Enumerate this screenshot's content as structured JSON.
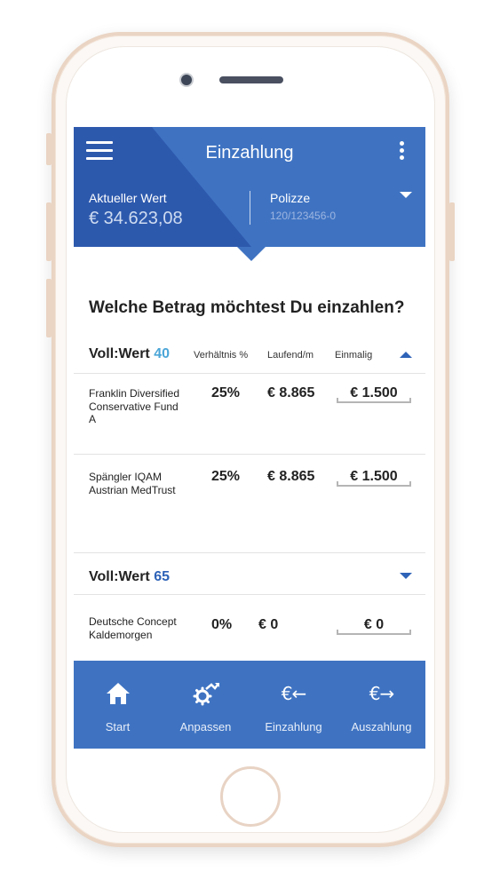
{
  "header": {
    "title": "Einzahlung",
    "current_value_label": "Aktueller Wert",
    "current_value": "€ 34.623,08",
    "policy_label": "Polizze",
    "policy_number": "120/123456-0"
  },
  "question": "Welche Betrag möchtest Du einzahlen?",
  "groups": [
    {
      "title_prefix": "Voll:Wert",
      "title_number": "40",
      "expanded": true,
      "columns": [
        "Verhältnis %",
        "Laufend/m",
        "Einmalig"
      ],
      "funds": [
        {
          "name": "Franklin Diversified Conservative Fund A",
          "pct": "25%",
          "laufend": "€ 8.865",
          "einmalig": "€ 1.500"
        },
        {
          "name": "Spängler IQAM Austrian MedTrust",
          "pct": "25%",
          "laufend": "€ 8.865",
          "einmalig": "€ 1.500"
        }
      ]
    },
    {
      "title_prefix": "Voll:Wert",
      "title_number": "65",
      "expanded": false,
      "funds": [
        {
          "name": "Deutsche Concept Kaldemorgen",
          "pct": "0%",
          "laufend": "€ 0",
          "einmalig": "€ 0"
        }
      ]
    }
  ],
  "nav": [
    {
      "label": "Start",
      "icon": "home-icon"
    },
    {
      "label": "Anpassen",
      "icon": "settings-arrow-icon"
    },
    {
      "label": "Einzahlung",
      "icon": "euro-in-icon",
      "glyph": "€←"
    },
    {
      "label": "Auszahlung",
      "icon": "euro-out-icon",
      "glyph": "€→"
    }
  ],
  "colors": {
    "primary_blue": "#3f73c2",
    "dark_blue": "#2d59ad",
    "accent_light": "#4ba6d8",
    "accent_dark": "#2e63b8"
  }
}
